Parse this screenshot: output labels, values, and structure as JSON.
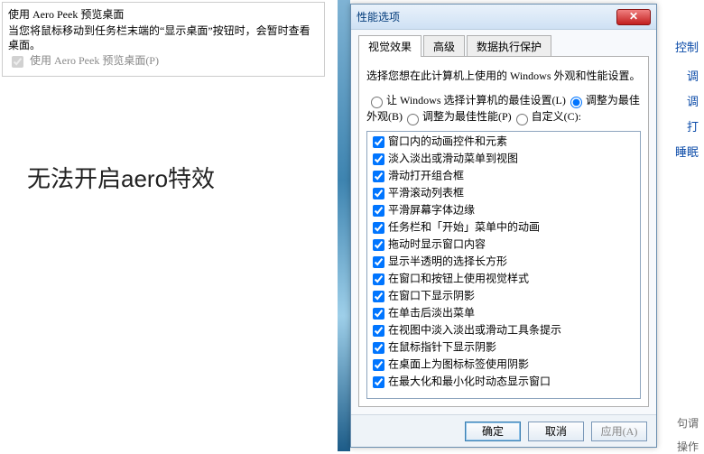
{
  "aero": {
    "title": "使用 Aero Peek 预览桌面",
    "desc": "当您将鼠标移动到任务栏末端的“显示桌面”按钮时，会暂时查看桌面。",
    "checkbox_label": "使用 Aero Peek 预览桌面(P)",
    "checked": true
  },
  "annotation": "无法开启aero特效",
  "side_links": [
    "控制",
    "调",
    "调",
    "打",
    "睡眠"
  ],
  "side_gray": [
    "句谓",
    "操作"
  ],
  "dialog": {
    "title": "性能选项",
    "tabs": [
      "视觉效果",
      "高级",
      "数据执行保护"
    ],
    "active_tab": 0,
    "desc": "选择您想在此计算机上使用的 Windows 外观和性能设置。",
    "radios": [
      {
        "label": "让 Windows 选择计算机的最佳设置(L)",
        "selected": false
      },
      {
        "label": "调整为最佳外观(B)",
        "selected": true
      },
      {
        "label": "调整为最佳性能(P)",
        "selected": false
      },
      {
        "label": "自定义(C):",
        "selected": false
      }
    ],
    "options": [
      "窗口内的动画控件和元素",
      "淡入淡出或滑动菜单到视图",
      "滑动打开组合框",
      "平滑滚动列表框",
      "平滑屏幕字体边缘",
      "任务栏和「开始」菜单中的动画",
      "拖动时显示窗口内容",
      "显示半透明的选择长方形",
      "在窗口和按钮上使用视觉样式",
      "在窗口下显示阴影",
      "在单击后淡出菜单",
      "在视图中淡入淡出或滑动工具条提示",
      "在鼠标指针下显示阴影",
      "在桌面上为图标标签使用阴影",
      "在最大化和最小化时动态显示窗口"
    ],
    "buttons": {
      "ok": "确定",
      "cancel": "取消",
      "apply": "应用(A)"
    }
  }
}
